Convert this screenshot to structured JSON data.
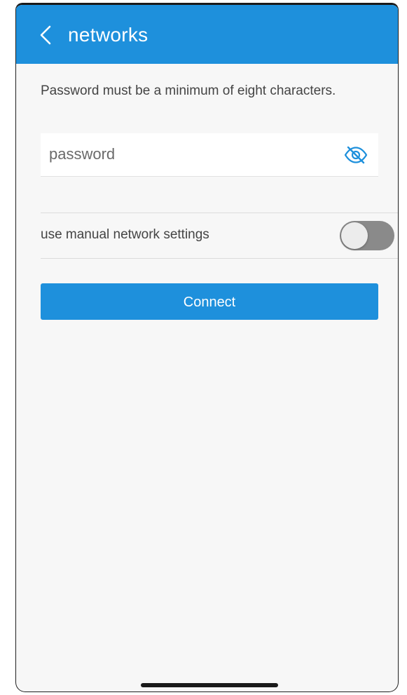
{
  "header": {
    "back_icon": "chevron-left-icon",
    "title": "networks"
  },
  "form": {
    "hint": "Password must be a minimum of eight characters.",
    "password_placeholder": "password",
    "password_value": "",
    "visibility_icon": "eye-off-icon"
  },
  "manual_settings": {
    "label": "use manual network settings",
    "enabled": false
  },
  "actions": {
    "connect_label": "Connect"
  },
  "colors": {
    "accent": "#1e90dc",
    "toggle_off": "#8a8a8a",
    "background": "#f7f7f7"
  }
}
